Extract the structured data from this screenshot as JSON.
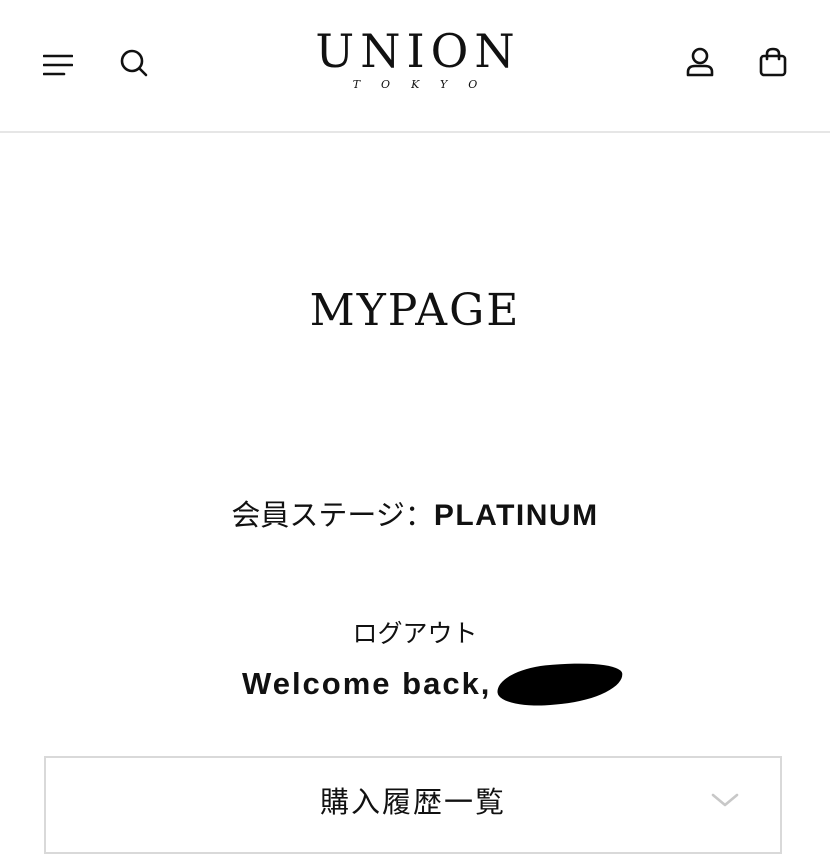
{
  "header": {
    "logo": {
      "main": "UNION",
      "sub": "TOKYO"
    },
    "icons": {
      "menu": "menu-icon",
      "search": "search-icon",
      "account": "user-icon",
      "cart": "shopping-bag-icon"
    }
  },
  "main": {
    "title": "MYPAGE",
    "member_stage": {
      "label": "会員ステージ：",
      "value": "PLATINUM"
    },
    "logout_label": "ログアウト",
    "welcome_text": "Welcome back,",
    "accordion": {
      "label": "購入履歴一覧"
    }
  },
  "colors": {
    "text": "#111111",
    "divider": "#e6e6e6",
    "border": "#d9d9d9",
    "chevron": "#c8c8c8",
    "background": "#ffffff"
  }
}
